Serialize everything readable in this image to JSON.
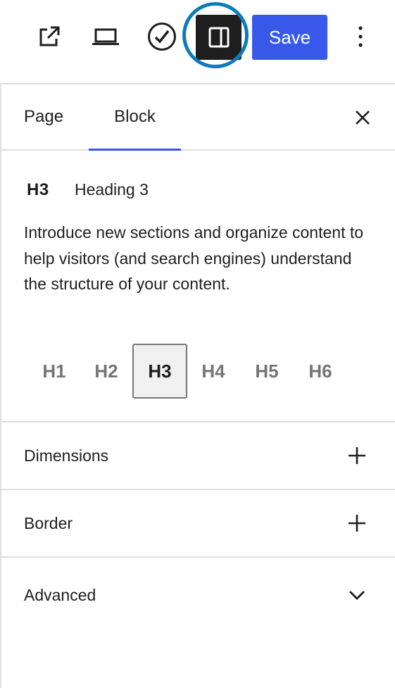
{
  "toolbar": {
    "view_icon": "external-link-icon",
    "preview_icon": "laptop-icon",
    "publish_check_icon": "check-circle-icon",
    "settings_icon": "sidebar-toggle-icon",
    "save_label": "Save",
    "more_icon": "vertical-ellipsis-icon",
    "accent_color": "#3858e9",
    "highlight_color": "#0b7bbd"
  },
  "sidebar": {
    "tabs": [
      {
        "label": "Page",
        "active": false
      },
      {
        "label": "Block",
        "active": true
      }
    ],
    "close_icon": "close-icon"
  },
  "block": {
    "type_icon": "H3",
    "title": "Heading 3",
    "description": "Introduce new sections and organize content to help visitors (and search engines) understand the structure of your content.",
    "levels": [
      "H1",
      "H2",
      "H3",
      "H4",
      "H5",
      "H6"
    ],
    "selected_level": "H3"
  },
  "sections": [
    {
      "label": "Dimensions",
      "icon": "plus-icon"
    },
    {
      "label": "Border",
      "icon": "plus-icon"
    },
    {
      "label": "Advanced",
      "icon": "chevron-down-icon"
    }
  ]
}
